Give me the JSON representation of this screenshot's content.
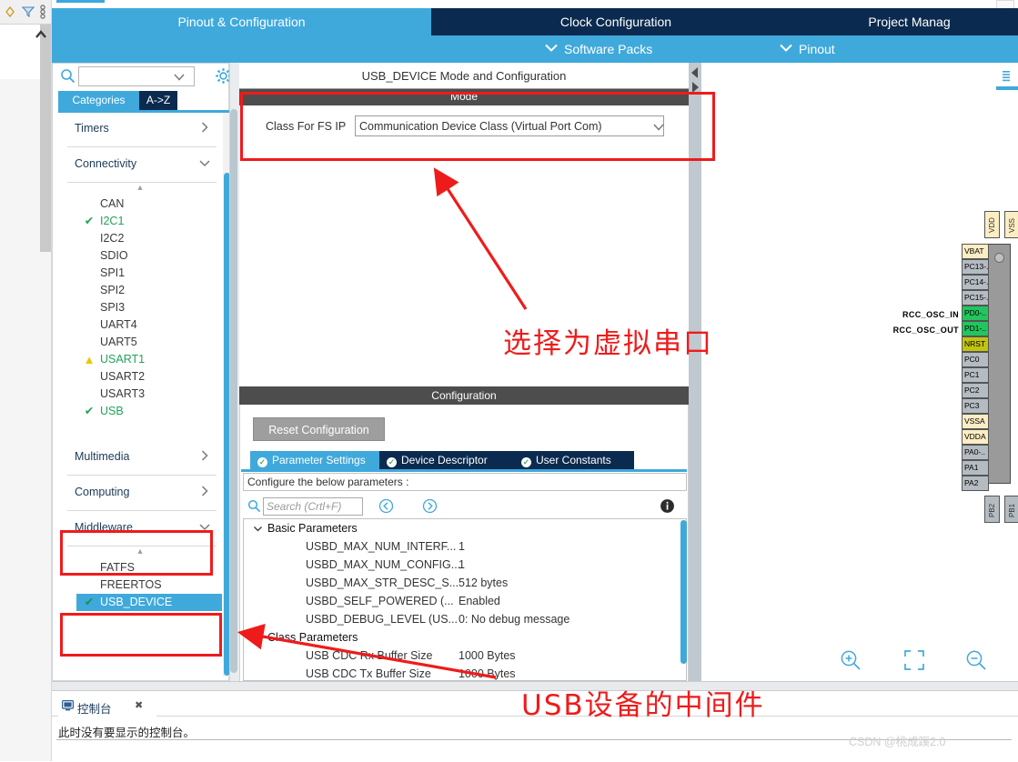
{
  "topnav": {
    "tabs": [
      {
        "label": "Pinout & Configuration",
        "active": true
      },
      {
        "label": "Clock Configuration",
        "active": false
      },
      {
        "label": "Project Manag",
        "active": false
      }
    ],
    "submenu": [
      {
        "label": "Software Packs",
        "icon": "chevron-down-icon"
      },
      {
        "label": "Pinout",
        "icon": "chevron-down-icon"
      }
    ]
  },
  "sidebar": {
    "search_value": "",
    "search_icon": "search-icon",
    "gear_icon": "gear-icon",
    "tabs": [
      {
        "label": "Categories",
        "active": true
      },
      {
        "label": "A->Z",
        "active": false
      }
    ],
    "groups": [
      {
        "label": "Timers",
        "expanded": false,
        "arrow": "chevron-right-icon",
        "items": []
      },
      {
        "label": "Connectivity",
        "expanded": true,
        "arrow": "chevron-down-icon",
        "items": [
          {
            "label": "CAN",
            "state": "none"
          },
          {
            "label": "I2C1",
            "state": "ok"
          },
          {
            "label": "I2C2",
            "state": "none"
          },
          {
            "label": "SDIO",
            "state": "none"
          },
          {
            "label": "SPI1",
            "state": "none"
          },
          {
            "label": "SPI2",
            "state": "none"
          },
          {
            "label": "SPI3",
            "state": "none"
          },
          {
            "label": "UART4",
            "state": "none"
          },
          {
            "label": "UART5",
            "state": "none"
          },
          {
            "label": "USART1",
            "state": "warn"
          },
          {
            "label": "USART2",
            "state": "none"
          },
          {
            "label": "USART3",
            "state": "none"
          },
          {
            "label": "USB",
            "state": "ok"
          }
        ]
      },
      {
        "label": "Multimedia",
        "expanded": false,
        "arrow": "chevron-right-icon",
        "items": []
      },
      {
        "label": "Computing",
        "expanded": false,
        "arrow": "chevron-right-icon",
        "items": []
      },
      {
        "label": "Middleware",
        "expanded": true,
        "arrow": "chevron-down-icon",
        "items": [
          {
            "label": "FATFS",
            "state": "none"
          },
          {
            "label": "FREERTOS",
            "state": "none"
          },
          {
            "label": "USB_DEVICE",
            "state": "ok",
            "selected": true
          }
        ]
      }
    ]
  },
  "center": {
    "title": "USB_DEVICE Mode and Configuration",
    "mode": {
      "header": "Mode",
      "field_label": "Class For FS IP",
      "field_value": "Communication Device Class (Virtual Port Com)",
      "dropdown_icon": "chevron-down-icon"
    },
    "configuration": {
      "header": "Configuration",
      "reset_button": "Reset Configuration",
      "tabs": [
        {
          "label": "Parameter Settings",
          "active": true,
          "icon": "check-circle-icon"
        },
        {
          "label": "Device Descriptor",
          "active": false,
          "icon": "check-circle-icon"
        },
        {
          "label": "User Constants",
          "active": false,
          "icon": "check-circle-icon"
        }
      ],
      "note": "Configure the below parameters :",
      "search_placeholder": "Search (Crtl+F)",
      "search_value": "",
      "prev_icon": "circle-left-icon",
      "next_icon": "circle-right-icon",
      "info_icon": "info-icon",
      "params": [
        {
          "type": "group",
          "label": "Basic Parameters",
          "expanded": true,
          "twisty": "chevron-down-icon"
        },
        {
          "type": "row",
          "name": "USBD_MAX_NUM_INTERF...",
          "value": "1"
        },
        {
          "type": "row",
          "name": "USBD_MAX_NUM_CONFIG...",
          "value": "1"
        },
        {
          "type": "row",
          "name": "USBD_MAX_STR_DESC_S...",
          "value": "512 bytes"
        },
        {
          "type": "row",
          "name": "USBD_SELF_POWERED (...",
          "value": "Enabled"
        },
        {
          "type": "row",
          "name": "USBD_DEBUG_LEVEL (US...",
          "value": "0: No debug message"
        },
        {
          "type": "group",
          "label": "Class Parameters",
          "expanded": true,
          "twisty": "chevron-down-icon"
        },
        {
          "type": "row",
          "name": "USB CDC Rx Buffer Size",
          "value": "1000 Bytes"
        },
        {
          "type": "row",
          "name": "USB CDC Tx Buffer Size",
          "value": "1000 Bytes"
        }
      ]
    }
  },
  "pinout": {
    "signal_labels": [
      {
        "label": "RCC_OSC_IN",
        "pin": "PD0-.."
      },
      {
        "label": "RCC_OSC_OUT",
        "pin": "PD1-.."
      }
    ],
    "left_pins": [
      {
        "label": "VBAT",
        "color": "cream"
      },
      {
        "label": "PC13-..",
        "color": "grey"
      },
      {
        "label": "PC14-..",
        "color": "grey"
      },
      {
        "label": "PC15-..",
        "color": "grey"
      },
      {
        "label": "PD0-..",
        "color": "green"
      },
      {
        "label": "PD1-..",
        "color": "green"
      },
      {
        "label": "NRST",
        "color": "olive"
      },
      {
        "label": "PC0",
        "color": "grey"
      },
      {
        "label": "PC1",
        "color": "grey"
      },
      {
        "label": "PC2",
        "color": "grey"
      },
      {
        "label": "PC3",
        "color": "grey"
      },
      {
        "label": "VSSA",
        "color": "cream"
      },
      {
        "label": "VDDA",
        "color": "cream"
      },
      {
        "label": "PA0-..",
        "color": "grey"
      },
      {
        "label": "PA1",
        "color": "grey"
      },
      {
        "label": "PA2",
        "color": "grey"
      }
    ],
    "top_pins": [
      {
        "label": "VDD",
        "color": "cream"
      },
      {
        "label": "VSS",
        "color": "cream"
      }
    ],
    "bottom_pins": [
      {
        "label": "PB2",
        "color": "grey"
      },
      {
        "label": "PB1",
        "color": "grey"
      }
    ],
    "toolbar": [
      {
        "name": "zoom-in-icon"
      },
      {
        "name": "fit-to-screen-icon"
      },
      {
        "name": "zoom-out-icon"
      }
    ]
  },
  "console": {
    "tab_label": "控制台",
    "tab_icon": "console-icon",
    "close_icon": "close-icon",
    "message": "此时没有要显示的控制台。"
  },
  "annotations": {
    "note_mode": "选择为虚拟串口",
    "note_middleware": "USB设备的中间件",
    "box_color": "#ef1b1b"
  },
  "watermark": "CSDN @桃成蹊2.0",
  "colors": {
    "accent_blue": "#3fa9dc",
    "dark_navy": "#0b2a4f",
    "header_grey": "#4d4d4d",
    "ok_green": "#22a35a",
    "warn_yellow": "#f2c200",
    "annotation_red": "#ef1b1b"
  }
}
